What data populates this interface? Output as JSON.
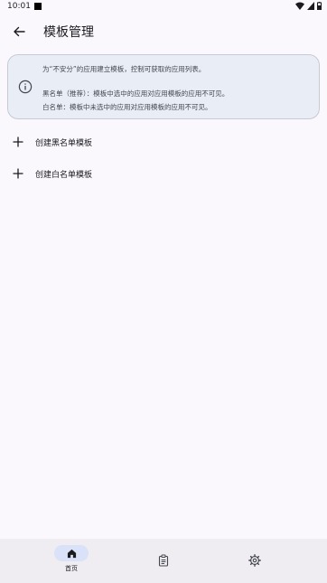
{
  "status_bar": {
    "time": "10:01"
  },
  "header": {
    "title": "模板管理",
    "back_icon": "arrow-left-icon"
  },
  "info_card": {
    "icon": "info-icon",
    "line1": "为“不安分”的应用建立模板，控制可获取的应用列表。",
    "line2": "黑名单（推荐）：模板中选中的应用对应用模板的应用不可见。",
    "line3": "白名单：模板中未选中的应用对应用模板的应用不可见。"
  },
  "actions": [
    {
      "icon": "plus-icon",
      "label": "创建黑名单模板"
    },
    {
      "icon": "plus-icon",
      "label": "创建白名单模板"
    }
  ],
  "bottom_nav": {
    "items": [
      {
        "icon": "home-icon",
        "label": "首页",
        "selected": true
      },
      {
        "icon": "clipboard-icon",
        "label": ""
      },
      {
        "icon": "gear-icon",
        "label": ""
      }
    ]
  },
  "colors": {
    "background": "#fbf8fd",
    "card_background": "#e9edf6",
    "nav_background": "#efedf1",
    "nav_indicator": "#d9e2f8"
  }
}
